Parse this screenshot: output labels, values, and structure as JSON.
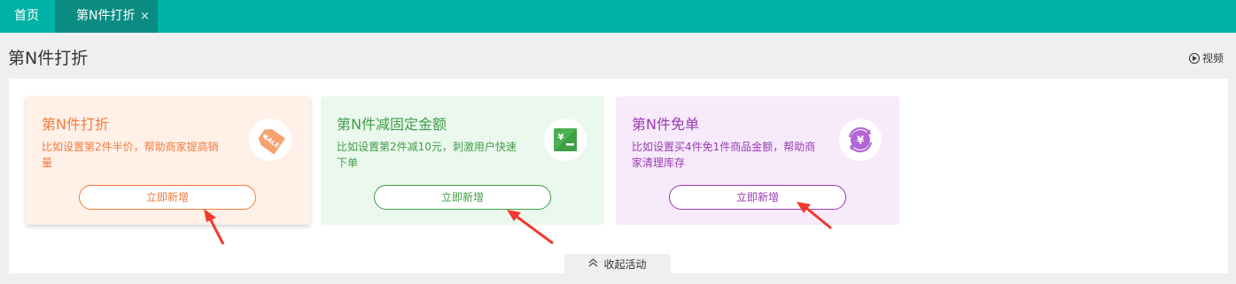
{
  "tabs": {
    "home_label": "首页",
    "active_label": "第N件打折",
    "close_symbol": "×"
  },
  "page": {
    "title": "第N件打折",
    "video_label": "视频"
  },
  "cards": [
    {
      "title": "第N件打折",
      "description": "比如设置第2件半价，帮助商家提高销量",
      "button_label": "立即新增",
      "icon": "sale-tag-icon",
      "color": "#f07c3b",
      "background": "#fff0e8"
    },
    {
      "title": "第N件减固定金额",
      "description": "比如设置第2件减10元，刺激用户快速下单",
      "button_label": "立即新增",
      "icon": "yen-minus-icon",
      "color": "#3f9e46",
      "background": "#ebf8ee"
    },
    {
      "title": "第N件免单",
      "description": "比如设置买4件免1件商品金额，帮助商家清理库存",
      "button_label": "立即新增",
      "icon": "yen-cycle-icon",
      "color": "#9b3bb3",
      "background": "#f6eafb"
    }
  ],
  "collapse": {
    "label": "收起活动"
  },
  "colors": {
    "topbar": "#00b2a6",
    "active_tab": "#0a8c82",
    "annotation_arrow": "#f23a2c"
  }
}
